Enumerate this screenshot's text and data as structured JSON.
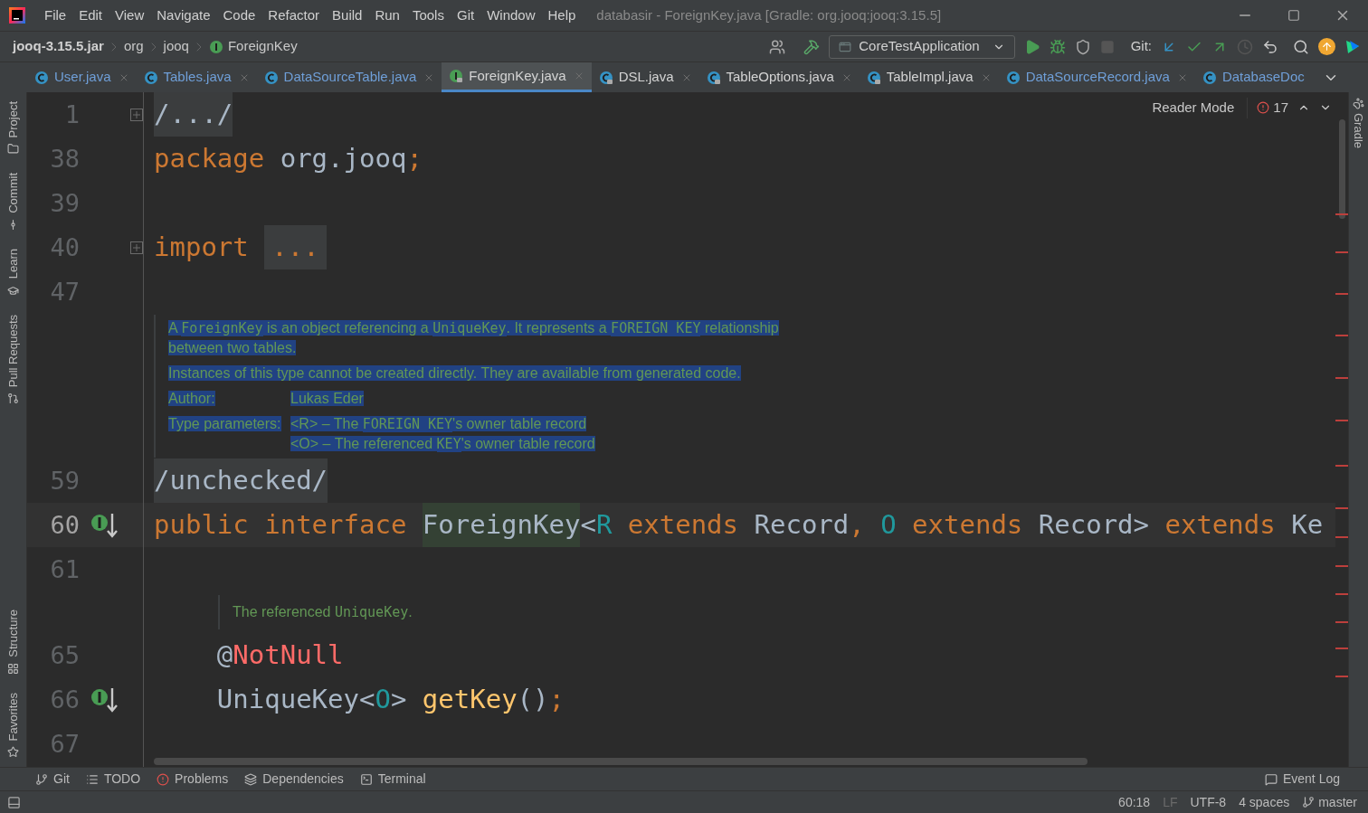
{
  "window": {
    "title": "databasir - ForeignKey.java [Gradle: org.jooq:jooq:3.15.5]"
  },
  "menu": [
    "File",
    "Edit",
    "View",
    "Navigate",
    "Code",
    "Refactor",
    "Build",
    "Run",
    "Tools",
    "Git",
    "Window",
    "Help"
  ],
  "breadcrumbs": [
    {
      "label": "jooq-3.15.5.jar",
      "kind": "jar"
    },
    {
      "label": "org",
      "kind": "package"
    },
    {
      "label": "jooq",
      "kind": "package"
    },
    {
      "label": "ForeignKey",
      "kind": "interface"
    }
  ],
  "toolbar": {
    "run_config": "CoreTestApplication",
    "git_label": "Git:"
  },
  "tabs": [
    {
      "label": "User.java",
      "kind": "class",
      "locked": false,
      "selected": false,
      "color": "#6f9fd8"
    },
    {
      "label": "Tables.java",
      "kind": "class",
      "locked": false,
      "selected": false,
      "color": "#6f9fd8"
    },
    {
      "label": "DataSourceTable.java",
      "kind": "class",
      "locked": false,
      "selected": false,
      "color": "#6f9fd8"
    },
    {
      "label": "ForeignKey.java",
      "kind": "interface",
      "locked": true,
      "selected": true,
      "color": "#d4d4d4"
    },
    {
      "label": "DSL.java",
      "kind": "class",
      "locked": true,
      "selected": false,
      "color": "#d4d4d4"
    },
    {
      "label": "TableOptions.java",
      "kind": "class",
      "locked": true,
      "selected": false,
      "color": "#d4d4d4"
    },
    {
      "label": "TableImpl.java",
      "kind": "class",
      "locked": true,
      "selected": false,
      "color": "#d4d4d4"
    },
    {
      "label": "DataSourceRecord.java",
      "kind": "class",
      "locked": false,
      "selected": false,
      "color": "#6f9fd8"
    },
    {
      "label": "DatabaseDoc",
      "kind": "class",
      "locked": false,
      "selected": false,
      "color": "#6f9fd8"
    }
  ],
  "left_tools": [
    "Project",
    "Commit",
    "Learn",
    "Pull Requests",
    "Structure",
    "Favorites"
  ],
  "right_tools": [
    "Gradle"
  ],
  "editor": {
    "reader_mode": "Reader Mode",
    "problem_count": "17",
    "lines": [
      {
        "kind": "code",
        "number": "1",
        "fold": true,
        "current": false,
        "implemented": false,
        "tokens": [
          {
            "text": "/.../",
            "kind": "folded"
          }
        ]
      },
      {
        "kind": "code",
        "number": "38",
        "fold": false,
        "current": false,
        "implemented": false,
        "tokens": [
          {
            "text": "package ",
            "kind": "keyword"
          },
          {
            "text": "org.jooq",
            "kind": "plain"
          },
          {
            "text": ";",
            "kind": "keyword"
          }
        ]
      },
      {
        "kind": "code",
        "number": "39",
        "fold": false,
        "current": false,
        "implemented": false
      },
      {
        "kind": "code",
        "number": "40",
        "fold": true,
        "current": false,
        "implemented": false,
        "tokens": [
          {
            "text": "import ",
            "kind": "keyword"
          },
          {
            "text": "...",
            "kind": "folded_keyword"
          }
        ]
      },
      {
        "kind": "code",
        "number": "47",
        "fold": false,
        "current": false,
        "implemented": false
      },
      {
        "kind": "doc",
        "selected": true,
        "indented": false,
        "blocks": [
          {
            "kind": "para",
            "segments": [
              {
                "text": "A ",
                "code": false
              },
              {
                "text": "ForeignKey",
                "code": true
              },
              {
                "text": " is an object referencing a ",
                "code": false
              },
              {
                "text": "UniqueKey",
                "code": true
              },
              {
                "text": ". It represents a ",
                "code": false
              },
              {
                "text": "FOREIGN KEY",
                "code": true
              },
              {
                "text": " relationship between two tables.",
                "code": false
              }
            ]
          },
          {
            "kind": "para",
            "segments": [
              {
                "text": "Instances of this type cannot be created directly. They are available from generated code.",
                "code": false
              }
            ]
          },
          {
            "kind": "tag",
            "label": "Author:",
            "values": [
              [
                {
                  "text": "Lukas Eder",
                  "code": false
                }
              ]
            ]
          },
          {
            "kind": "tag",
            "label": "Type parameters:",
            "values": [
              [
                {
                  "text": "<R> – The ",
                  "code": false
                },
                {
                  "text": "FOREIGN KEY",
                  "code": true
                },
                {
                  "text": "'s owner table record",
                  "code": false
                }
              ],
              [
                {
                  "text": "<O> – The referenced ",
                  "code": false
                },
                {
                  "text": "KEY",
                  "code": true
                },
                {
                  "text": "'s owner table record",
                  "code": false
                }
              ]
            ]
          }
        ]
      },
      {
        "kind": "code",
        "number": "59",
        "fold": false,
        "current": false,
        "implemented": false,
        "tokens": [
          {
            "text": "/unchecked/",
            "kind": "folded"
          }
        ]
      },
      {
        "kind": "code",
        "number": "60",
        "fold": false,
        "current": true,
        "implemented": true,
        "tokens": [
          {
            "text": "public interface ",
            "kind": "keyword"
          },
          {
            "text": "ForeignKey",
            "kind": "highlight"
          },
          {
            "text": "<",
            "kind": "plain"
          },
          {
            "text": "R",
            "kind": "typeparam"
          },
          {
            "text": " extends ",
            "kind": "keyword"
          },
          {
            "text": "Record",
            "kind": "plain"
          },
          {
            "text": ", ",
            "kind": "keyword"
          },
          {
            "text": "O",
            "kind": "typeparam"
          },
          {
            "text": " extends ",
            "kind": "keyword"
          },
          {
            "text": "Record",
            "kind": "plain"
          },
          {
            "text": "> ",
            "kind": "plain"
          },
          {
            "text": "extends ",
            "kind": "keyword"
          },
          {
            "text": "Ke",
            "kind": "plain"
          }
        ]
      },
      {
        "kind": "code",
        "number": "61",
        "fold": false,
        "current": false,
        "implemented": false
      },
      {
        "kind": "doc",
        "selected": false,
        "indented": true,
        "blocks": [
          {
            "kind": "para",
            "segments": [
              {
                "text": "The referenced ",
                "code": false
              },
              {
                "text": "UniqueKey",
                "code": true
              },
              {
                "text": ".",
                "code": false
              }
            ]
          }
        ]
      },
      {
        "kind": "code",
        "number": "65",
        "fold": false,
        "current": false,
        "implemented": false,
        "tokens": [
          {
            "text": "    @",
            "kind": "plain"
          },
          {
            "text": "NotNull",
            "kind": "error"
          }
        ]
      },
      {
        "kind": "code",
        "number": "66",
        "fold": false,
        "current": false,
        "implemented": true,
        "tokens": [
          {
            "text": "    UniqueKey<",
            "kind": "plain"
          },
          {
            "text": "O",
            "kind": "typeparam"
          },
          {
            "text": "> ",
            "kind": "plain"
          },
          {
            "text": "getKey",
            "kind": "method"
          },
          {
            "text": "()",
            "kind": "plain"
          },
          {
            "text": ";",
            "kind": "keyword"
          }
        ]
      },
      {
        "kind": "code",
        "number": "67",
        "fold": false,
        "current": false,
        "implemented": false
      }
    ]
  },
  "tool_windows": [
    {
      "label": "Git",
      "kind": "branch"
    },
    {
      "label": "TODO",
      "kind": "list"
    },
    {
      "label": "Problems",
      "kind": "error"
    },
    {
      "label": "Dependencies",
      "kind": "layers"
    },
    {
      "label": "Terminal",
      "kind": "terminal"
    },
    {
      "label": "Event Log",
      "kind": "log"
    }
  ],
  "status_bar": {
    "position": "60:18",
    "line_separator": "LF",
    "encoding": "UTF-8",
    "indent": "4 spaces",
    "branch": "master"
  }
}
